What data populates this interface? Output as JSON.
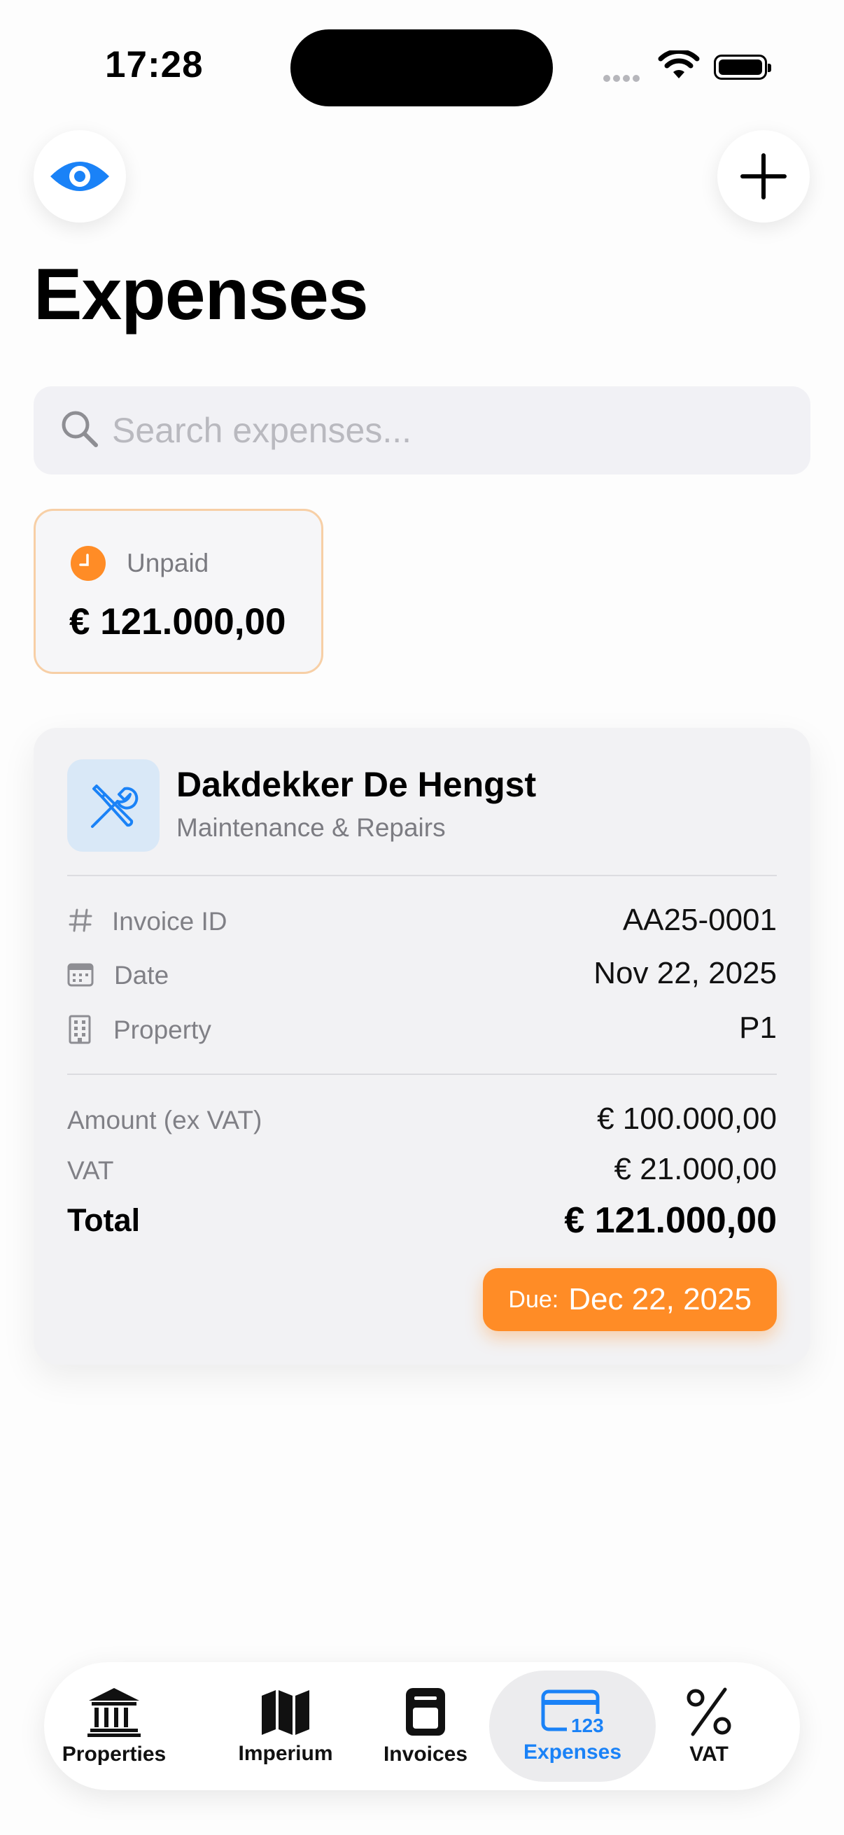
{
  "status_bar": {
    "time": "17:28"
  },
  "header": {
    "title": "Expenses"
  },
  "search": {
    "placeholder": "Search expenses..."
  },
  "summary": {
    "label": "Unpaid",
    "amount": "€ 121.000,00"
  },
  "expense": {
    "vendor": "Dakdekker De Hengst",
    "category": "Maintenance & Repairs",
    "details": [
      {
        "icon": "hash-icon",
        "label": "Invoice ID",
        "value": "AA25-0001"
      },
      {
        "icon": "calendar-icon",
        "label": "Date",
        "value": "Nov 22, 2025"
      },
      {
        "icon": "building-icon",
        "label": "Property",
        "value": "P1"
      }
    ],
    "amount_label": "Amount (ex VAT)",
    "amount_value": "€ 100.000,00",
    "vat_label": "VAT",
    "vat_value": "€ 21.000,00",
    "total_label": "Total",
    "total_value": "€ 121.000,00",
    "due_prefix": "Due:",
    "due_date": "Dec 22, 2025"
  },
  "tabs": [
    {
      "label": "Properties",
      "icon": "bank-icon"
    },
    {
      "label": "Imperium",
      "icon": "map-icon"
    },
    {
      "label": "Invoices",
      "icon": "document-icon"
    },
    {
      "label": "Expenses",
      "icon": "credit-card-icon",
      "active": true
    },
    {
      "label": "VAT",
      "icon": "percent-icon"
    }
  ],
  "colors": {
    "accent": "#1a82f7",
    "warning": "#ff8c26",
    "category_bg": "#d9e8f7"
  }
}
